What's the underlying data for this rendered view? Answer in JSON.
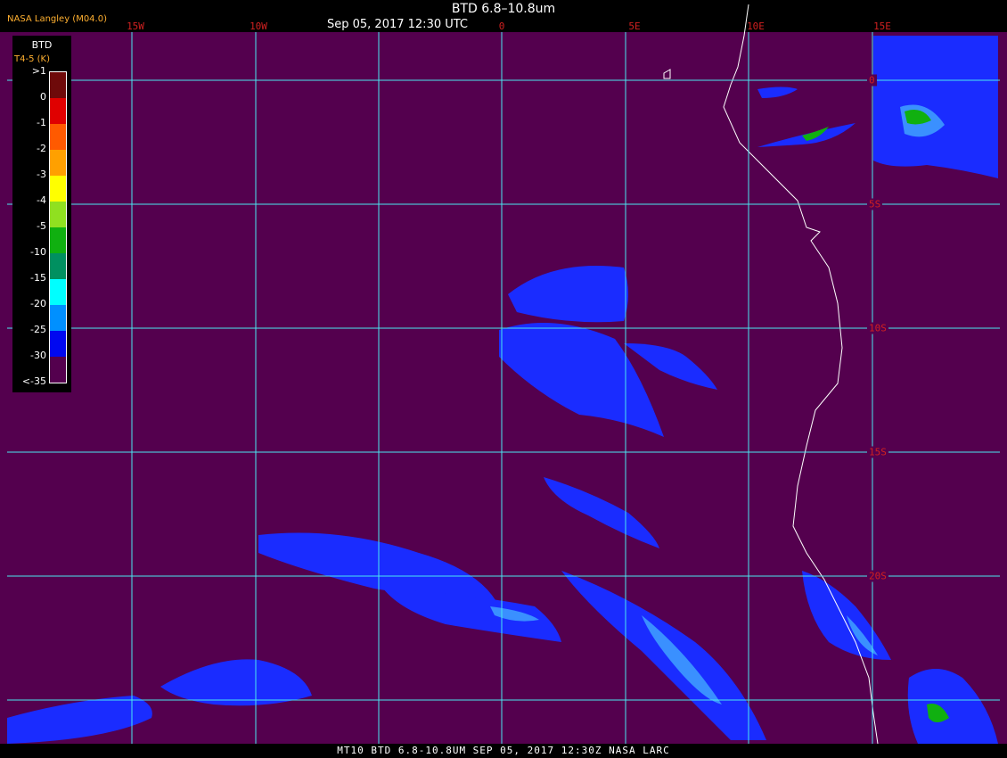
{
  "header": {
    "title": "BTD 6.8–10.8um",
    "subtitle": "Sep 05, 2017 12:30 UTC",
    "credit": "NASA Langley (M04.0)"
  },
  "footer": {
    "text": "MT10  BTD 6.8-10.8UM  SEP 05, 2017 12:30Z  NASA LARC"
  },
  "grid": {
    "longitudes": [
      "15W",
      "10W",
      "5W",
      "0",
      "5E",
      "10E",
      "15E"
    ],
    "latitudes": [
      "0",
      "5S",
      "10S",
      "15S",
      "20S"
    ],
    "color": "#4ae8f0"
  },
  "legend": {
    "title": "BTD",
    "units": "T4-5 (K)",
    "entries": [
      {
        "label": ">1",
        "color": "#6e0a0a"
      },
      {
        "label": "0",
        "color": "#e00000"
      },
      {
        "label": "-1",
        "color": "#ff5a00"
      },
      {
        "label": "-2",
        "color": "#ffa000"
      },
      {
        "label": "-3",
        "color": "#ffff00"
      },
      {
        "label": "-4",
        "color": "#90e020"
      },
      {
        "label": "-5",
        "color": "#10b010"
      },
      {
        "label": "-10",
        "color": "#009060"
      },
      {
        "label": "-15",
        "color": "#00ffff"
      },
      {
        "label": "-20",
        "color": "#0090ff"
      },
      {
        "label": "-25",
        "color": "#0008f0"
      },
      {
        "label": "-30",
        "color": "#54004e"
      },
      {
        "label": "<-35",
        "color": "#54004e"
      }
    ]
  },
  "colors": {
    "background": "#54004e",
    "coastline": "#ffffff",
    "cloud_blue": "#1a2cff",
    "cloud_light": "#3a90ff"
  }
}
